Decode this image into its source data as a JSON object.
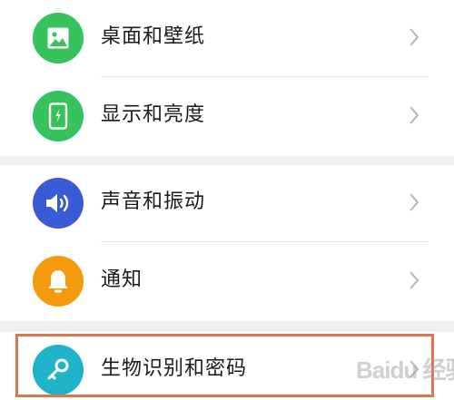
{
  "settings_list": {
    "groups": [
      {
        "items": [
          {
            "label": "桌面和壁纸",
            "icon": "image-icon",
            "icon_color": "#38c25c"
          },
          {
            "label": "显示和亮度",
            "icon": "phone-brightness-icon",
            "icon_color": "#38c25c"
          }
        ]
      },
      {
        "items": [
          {
            "label": "声音和振动",
            "icon": "speaker-icon",
            "icon_color": "#3b5bd6"
          },
          {
            "label": "通知",
            "icon": "bell-icon",
            "icon_color": "#f59a0d"
          }
        ]
      },
      {
        "items": [
          {
            "label": "生物识别和密码",
            "icon": "key-icon",
            "icon_color": "#20b3c9"
          }
        ]
      }
    ]
  },
  "watermark": {
    "text": "Baidu 经验"
  },
  "colors": {
    "background": "#f1f1f1",
    "card": "#ffffff",
    "highlight": "#d9774f",
    "chevron": "#b5b5b5"
  }
}
